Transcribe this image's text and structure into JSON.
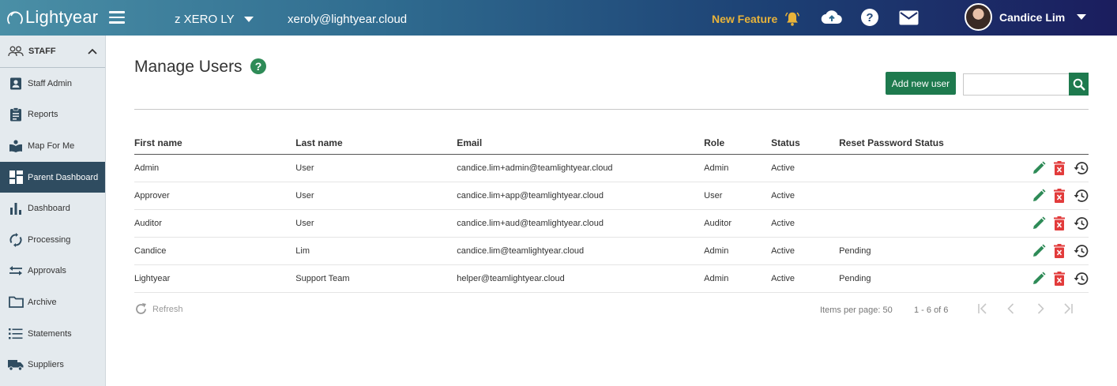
{
  "header": {
    "logo_text": "Lightyear",
    "org_name": "z XERO LY",
    "org_email": "xeroly@lightyear.cloud",
    "new_feature_label": "New Feature",
    "user_name": "Candice Lim",
    "icons": [
      "menu-icon",
      "bell-icon",
      "cloud-upload-icon",
      "help-icon",
      "mail-icon",
      "avatar"
    ]
  },
  "sidebar": {
    "section_label": "STAFF",
    "items": [
      {
        "label": "Staff Admin",
        "icon": "person-badge-icon"
      },
      {
        "label": "Reports",
        "icon": "clipboard-icon"
      },
      {
        "label": "Map For Me",
        "icon": "map-reader-icon"
      },
      {
        "label": "Parent Dashboard",
        "icon": "dashboard-icon",
        "active": true
      },
      {
        "label": "Dashboard",
        "icon": "bar-chart-icon"
      },
      {
        "label": "Processing",
        "icon": "sync-icon"
      },
      {
        "label": "Approvals",
        "icon": "swap-icon"
      },
      {
        "label": "Archive",
        "icon": "folder-icon"
      },
      {
        "label": "Statements",
        "icon": "list-icon"
      },
      {
        "label": "Suppliers",
        "icon": "truck-icon"
      }
    ]
  },
  "main": {
    "title": "Manage Users",
    "add_button_label": "Add new user",
    "search_placeholder": "",
    "columns": [
      "First name",
      "Last name",
      "Email",
      "Role",
      "Status",
      "Reset Password Status"
    ],
    "rows": [
      {
        "first": "Admin",
        "last": "User",
        "email": "candice.lim+admin@teamlightyear.cloud",
        "role": "Admin",
        "status": "Active",
        "reset": ""
      },
      {
        "first": "Approver",
        "last": "User",
        "email": "candice.lim+app@teamlightyear.cloud",
        "role": "User",
        "status": "Active",
        "reset": ""
      },
      {
        "first": "Auditor",
        "last": "User",
        "email": "candice.lim+aud@teamlightyear.cloud",
        "role": "Auditor",
        "status": "Active",
        "reset": ""
      },
      {
        "first": "Candice",
        "last": "Lim",
        "email": "candice.lim@teamlightyear.cloud",
        "role": "Admin",
        "status": "Active",
        "reset": "Pending"
      },
      {
        "first": "Lightyear",
        "last": "Support Team",
        "email": "helper@teamlightyear.cloud",
        "role": "Admin",
        "status": "Active",
        "reset": "Pending"
      }
    ],
    "refresh_label": "Refresh",
    "items_per_page_label": "Items per page: 50",
    "range_label": "1 - 6 of 6"
  },
  "colors": {
    "accent_green": "#1e7a4e",
    "edit_green": "#2e8b57",
    "delete_red": "#e23b3b",
    "new_feature_gold": "#e8b33a",
    "sidebar_active": "#2f4c60"
  }
}
